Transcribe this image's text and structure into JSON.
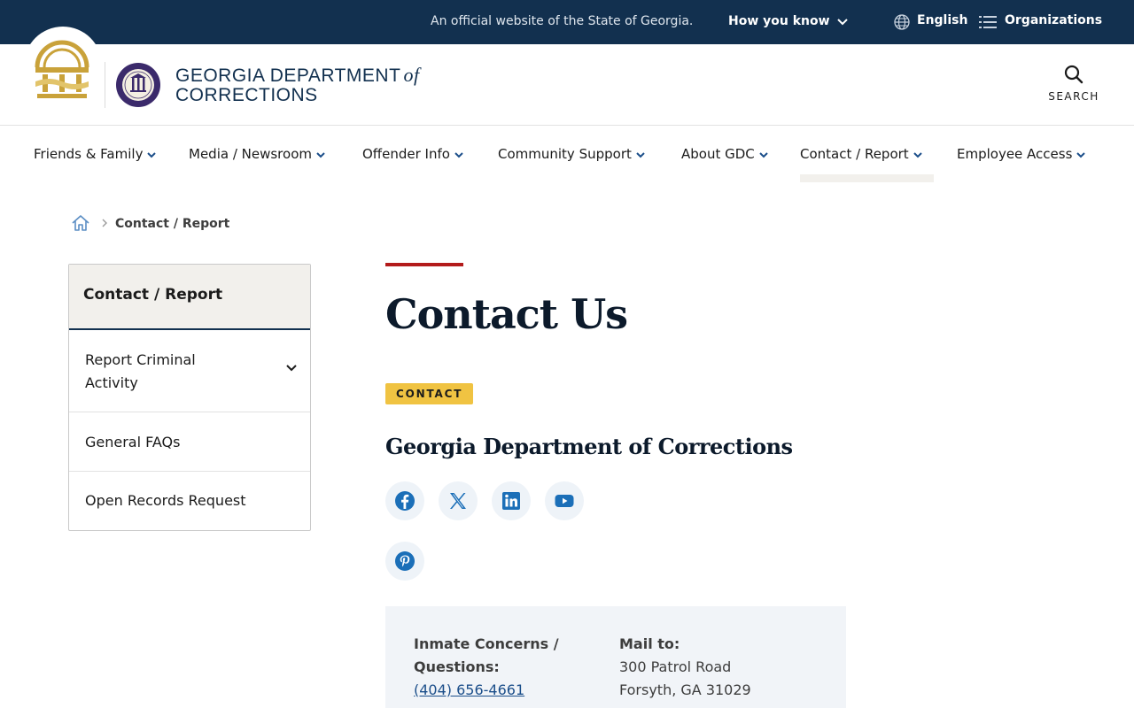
{
  "topbar": {
    "official_text": "An official website of the State of Georgia.",
    "how_you_know": "How you know",
    "language": "English",
    "organizations": "Organizations"
  },
  "header": {
    "brand_line1": "GEORGIA DEPARTMENT",
    "brand_of": "of",
    "brand_line2": "CORRECTIONS",
    "search_label": "SEARCH"
  },
  "nav": {
    "items": [
      {
        "label": "Friends & Family"
      },
      {
        "label": "Media / Newsroom"
      },
      {
        "label": "Offender Info"
      },
      {
        "label": "Community Support"
      },
      {
        "label": "About GDC"
      },
      {
        "label": "Contact / Report"
      },
      {
        "label": "Employee Access"
      }
    ],
    "active": "Contact / Report"
  },
  "breadcrumb": {
    "current": "Contact / Report"
  },
  "sidenav": {
    "title": "Contact / Report",
    "items": [
      {
        "label": "Report Criminal Activity"
      },
      {
        "label": "General FAQs"
      },
      {
        "label": "Open Records Request"
      }
    ]
  },
  "main": {
    "title": "Contact Us",
    "tag": "CONTACT",
    "org_name": "Georgia Department of Corrections",
    "social": [
      "facebook-icon",
      "x-icon",
      "linkedin-icon",
      "youtube-icon",
      "pinterest-icon"
    ],
    "card": {
      "concerns_label": "Inmate Concerns / Questions:",
      "concerns_phone": "(404) 656-4661",
      "mail_label": "Mail to:",
      "mail_line1": "300 Patrol Road",
      "mail_line2": "Forsyth, GA 31029"
    }
  },
  "colors": {
    "navy": "#12304f",
    "accent_red": "#b31b1b",
    "tag_yellow": "#f0c342",
    "seal_gold": "#c9a23a",
    "link_blue": "#1b4e8a"
  }
}
